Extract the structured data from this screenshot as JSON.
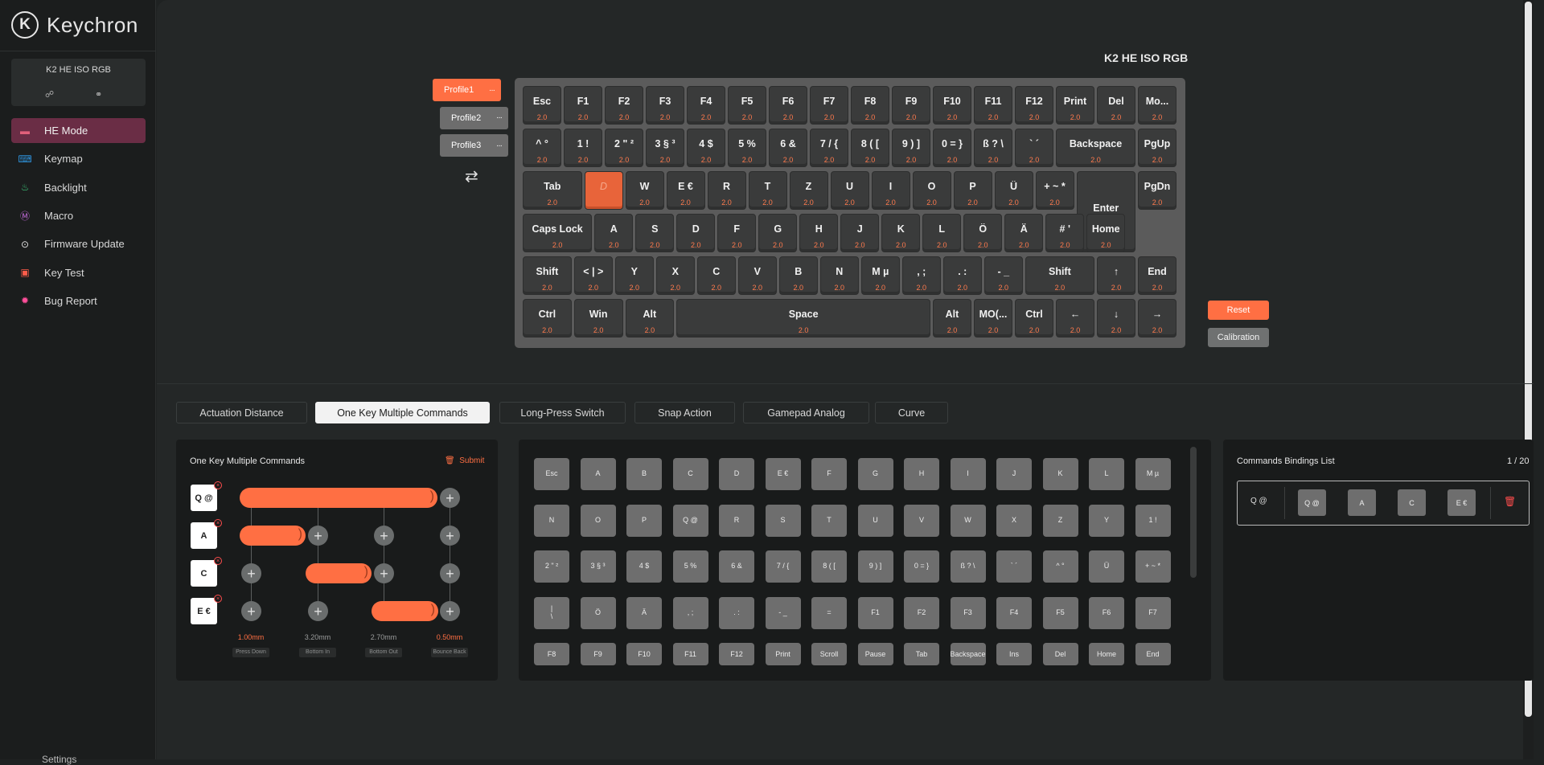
{
  "app": {
    "logo_mark": "K",
    "logo_text": "Keychron"
  },
  "device": {
    "name": "K2 HE ISO RGB",
    "icon1": "link-icon",
    "icon2": "unlink-icon"
  },
  "nav": [
    {
      "label": "HE Mode",
      "icon": "he-mode-icon",
      "color": "#e0607a",
      "active": true
    },
    {
      "label": "Keymap",
      "icon": "keymap-icon",
      "color": "#2e8fd6"
    },
    {
      "label": "Backlight",
      "icon": "bulb-icon",
      "color": "#3cc77a"
    },
    {
      "label": "Macro",
      "icon": "macro-icon",
      "color": "#c46bdc"
    },
    {
      "label": "Firmware Update",
      "icon": "update-icon",
      "color": "#e0e0e0"
    },
    {
      "label": "Key Test",
      "icon": "keytest-icon",
      "color": "#ff5c4a"
    },
    {
      "label": "Bug Report",
      "icon": "bug-icon",
      "color": "#ff4f9a"
    }
  ],
  "settings_label": "Settings",
  "model_title": "K2 HE ISO RGB",
  "profiles": [
    {
      "label": "Profile1",
      "active": true
    },
    {
      "label": "Profile2",
      "active": false
    },
    {
      "label": "Profile3",
      "active": false
    }
  ],
  "profile_menu_glyph": "···",
  "swap_icon": "swap-icon",
  "actuation": "2.0",
  "keyboard_rows": [
    [
      "Esc",
      "F1",
      "F2",
      "F3",
      "F4",
      "F5",
      "F6",
      "F7",
      "F8",
      "F9",
      "F10",
      "F11",
      "F12",
      "Print",
      "Del",
      "Mo..."
    ],
    [
      "^ °",
      "1 !",
      "2 \" ²",
      "3 § ³",
      "4 $",
      "5 %",
      "6 &",
      "7 / {",
      "8 ( [",
      "9 ) ]",
      "0 = }",
      "ß ? \\",
      "` ´",
      "Backspace",
      "PgUp"
    ],
    [
      "Tab",
      "D",
      "W",
      "E €",
      "R",
      "T",
      "Z",
      "U",
      "I",
      "O",
      "P",
      "Ü",
      "+ ~ *",
      "Enter",
      "PgDn"
    ],
    [
      "Caps Lock",
      "A",
      "S",
      "D",
      "F",
      "G",
      "H",
      "J",
      "K",
      "L",
      "Ö",
      "Ä",
      "# '",
      "Home"
    ],
    [
      "Shift",
      "< | >",
      "Y",
      "X",
      "C",
      "V",
      "B",
      "N",
      "M µ",
      ", ;",
      ". :",
      "- _",
      "Shift",
      "↑",
      "End"
    ],
    [
      "Ctrl",
      "Win",
      "Alt",
      "Space",
      "Alt",
      "MO(...",
      "Ctrl",
      "←",
      "↓",
      "→"
    ]
  ],
  "buttons": {
    "reset": "Reset",
    "calibration": "Calibration"
  },
  "tabs": [
    {
      "label": "Actuation Distance",
      "active": false
    },
    {
      "label": "One Key Multiple Commands",
      "active": true
    },
    {
      "label": "Long-Press Switch",
      "active": false
    },
    {
      "label": "Snap Action",
      "active": false
    },
    {
      "label": "Gamepad Analog",
      "active": false
    },
    {
      "label": "Curve",
      "active": false
    }
  ],
  "okmc": {
    "title": "One Key Multiple Commands",
    "submit": "Submit",
    "keys": [
      "Q @",
      "A",
      "C",
      "E €"
    ],
    "remove_glyph": "×",
    "plus_glyph": "+",
    "values": [
      {
        "value": "1.00mm",
        "label": "Press Down",
        "highlight": true
      },
      {
        "value": "3.20mm",
        "label": "Bottom In",
        "highlight": false
      },
      {
        "value": "2.70mm",
        "label": "Bottom Out",
        "highlight": false
      },
      {
        "value": "0.50mm",
        "label": "Bounce Back",
        "highlight": true
      }
    ]
  },
  "key_grid": [
    [
      "Esc",
      "A",
      "B",
      "C",
      "D",
      "E €",
      "F",
      "G",
      "H",
      "I",
      "J",
      "K",
      "L",
      "M µ"
    ],
    [
      "N",
      "O",
      "P",
      "Q @",
      "R",
      "S",
      "T",
      "U",
      "V",
      "W",
      "X",
      "Z",
      "Y",
      "1 !"
    ],
    [
      "2 \" ²",
      "3 § ³",
      "4 $",
      "5 %",
      "6 &",
      "7 / {",
      "8 ( [",
      "9 ) ]",
      "0 = }",
      "ß ? \\",
      "` ´",
      "^ °",
      "Ü",
      "+ ~ *"
    ],
    [
      "|\n\\",
      "Ö",
      "Ä",
      ", ;",
      ". :",
      "- _",
      "=",
      "F1",
      "F2",
      "F3",
      "F4",
      "F5",
      "F6",
      "F7"
    ],
    [
      "F8",
      "F9",
      "F10",
      "F11",
      "F12",
      "Print",
      "Scroll",
      "Pause",
      "Tab",
      "Backspace",
      "Ins",
      "Del",
      "Home",
      "End"
    ]
  ],
  "bindings": {
    "title": "Commands Bindings List",
    "count": "1 / 20",
    "source_key": "Q @",
    "bound_keys": [
      "Q @",
      "A",
      "C",
      "E €"
    ],
    "delete_icon": "trash-icon"
  }
}
